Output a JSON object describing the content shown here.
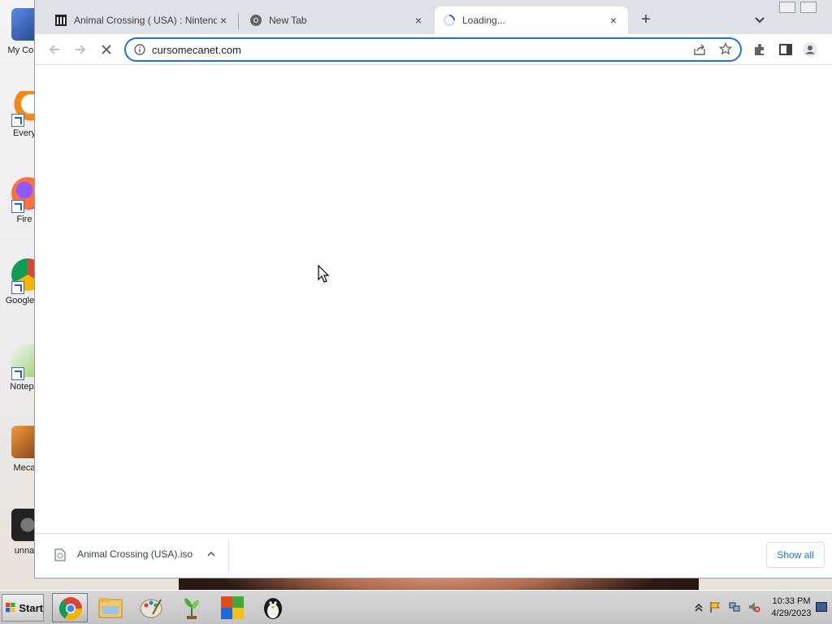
{
  "desktop": {
    "icons": [
      {
        "label": "My Com"
      },
      {
        "label": "Every"
      },
      {
        "label": "Fire"
      },
      {
        "label": "Google C"
      },
      {
        "label": "Notepa"
      },
      {
        "label": "Meca"
      },
      {
        "label": "unna"
      }
    ]
  },
  "browser": {
    "tabs": [
      {
        "title": "Animal Crossing ( USA) : Nintendo G",
        "favicon": "archive-icon",
        "close": "×"
      },
      {
        "title": "New Tab",
        "favicon": "chrome-icon",
        "close": "×"
      },
      {
        "title": "Loading...",
        "favicon": "spinner-icon",
        "close": "×"
      }
    ],
    "new_tab_label": "+",
    "address_bar": {
      "url": "cursomecanet.com"
    },
    "download_bar": {
      "file_name": "Animal Crossing (USA).iso",
      "show_all_label": "Show all"
    }
  },
  "taskbar": {
    "start_label": "Start",
    "clock_time": "10:33 PM",
    "clock_date": "4/29/2023",
    "apps": [
      "chrome-icon",
      "file-explorer-icon",
      "paint-icon",
      "plant-app-icon",
      "office-icon",
      "penguin-app-icon"
    ]
  },
  "colors": {
    "accent": "#1a73e8",
    "tabstrip": "#dee1e6",
    "taskbar": "#c4c4c4"
  }
}
